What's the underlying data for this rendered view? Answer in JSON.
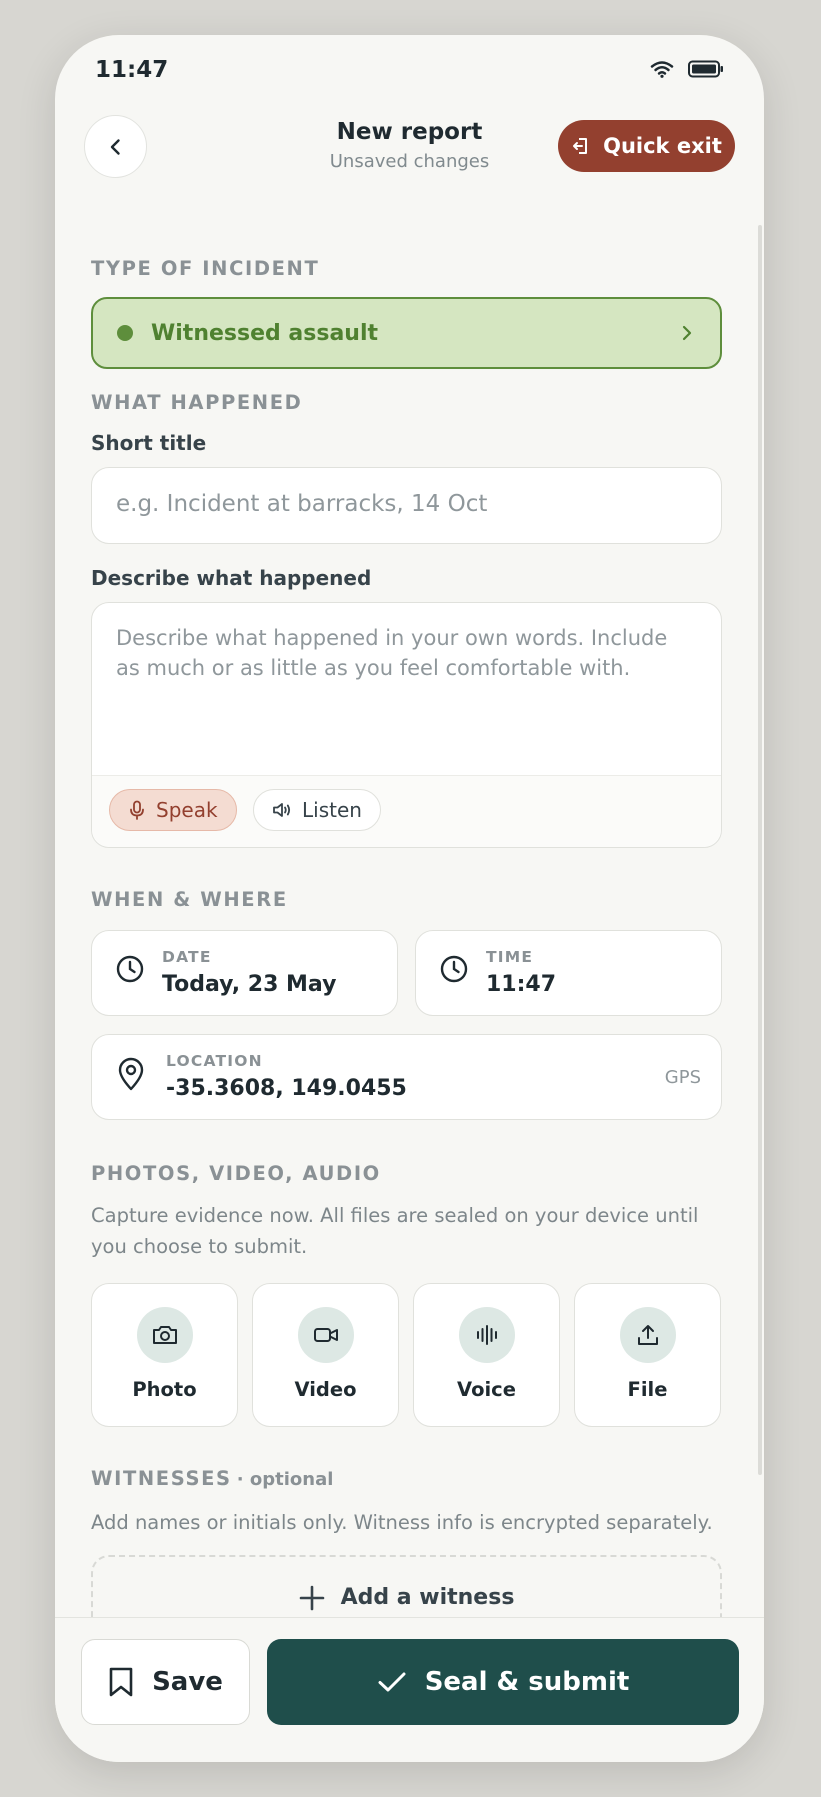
{
  "status_bar": {
    "time": "11:47",
    "wifi_icon": "wifi-icon",
    "battery_icon": "battery-icon"
  },
  "header": {
    "title": "New report",
    "subtitle": "Unsaved changes",
    "quick_exit_label": "Quick exit"
  },
  "incident": {
    "section_label": "TYPE OF INCIDENT",
    "selected": "Witnessed assault"
  },
  "what_happened": {
    "section_label": "WHAT HAPPENED",
    "title_label": "Short title",
    "title_placeholder": "e.g. Incident at barracks, 14 Oct",
    "description_label": "Describe what happened",
    "description_placeholder": "Describe what happened in your own words. Include as much or as little as you feel comfortable with.",
    "speak_label": "Speak",
    "listen_label": "Listen"
  },
  "when_where": {
    "section_label": "WHEN & WHERE",
    "date_caption": "DATE",
    "date_value": "Today, 23 May",
    "time_caption": "TIME",
    "time_value": "11:47",
    "location_caption": "LOCATION",
    "location_value": "-35.3608, 149.0455",
    "location_source": "GPS"
  },
  "media": {
    "section_label": "PHOTOS, VIDEO, AUDIO",
    "help": "Capture evidence now. All files are sealed on your device until you choose to submit.",
    "buttons": [
      {
        "label": "Photo",
        "icon": "camera-icon"
      },
      {
        "label": "Video",
        "icon": "video-icon"
      },
      {
        "label": "Voice",
        "icon": "waveform-icon"
      },
      {
        "label": "File",
        "icon": "upload-icon"
      }
    ]
  },
  "witnesses": {
    "section_label": "WITNESSES",
    "optional_label": "· optional",
    "help": "Add names or initials only. Witness info is encrypted separately.",
    "add_label": "Add a witness"
  },
  "bottom": {
    "save_label": "Save",
    "submit_label": "Seal & submit"
  },
  "colors": {
    "accent": "#1f4e4b",
    "danger": "#93402f",
    "success": "#5e8e3c",
    "success_bg": "#d5e6c1"
  }
}
